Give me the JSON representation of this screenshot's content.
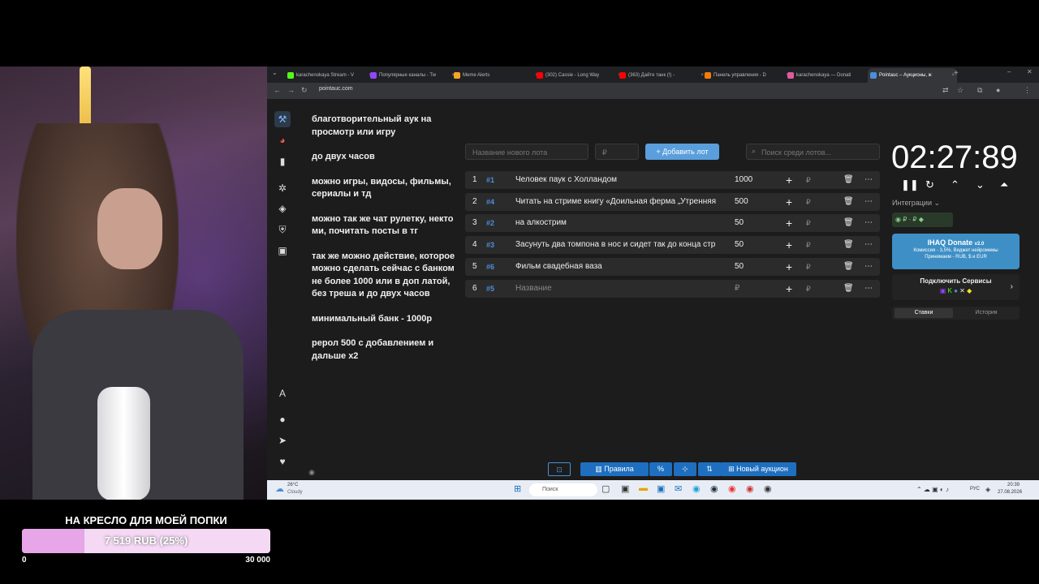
{
  "goal": {
    "title": "НА КРЕСЛО ДЛЯ МОЕЙ ПОПКИ",
    "progress_text": "7 519 RUB (25%)",
    "progress": 0.25,
    "min": "0",
    "max": "30 000",
    "fill_color": "#e6a6e8"
  },
  "browser": {
    "tabs": [
      {
        "label": "karachenokaya Stream - V",
        "icon_color": "#53fc18"
      },
      {
        "label": "Популярные каналы - Tw",
        "icon_color": "#9146ff"
      },
      {
        "label": "Meme Alerts",
        "icon_color": "#f5a623"
      },
      {
        "label": "(302) Cassie - Long Way",
        "icon_color": "#ff0000"
      },
      {
        "label": "(363) Дайте танк (!) -",
        "icon_color": "#ff0000"
      },
      {
        "label": "Панель управления - D",
        "icon_color": "#f57d07"
      },
      {
        "label": "karachenokaya — Donati",
        "icon_color": "#e05aa0"
      },
      {
        "label": "Pointauc – Аукционы, ж",
        "icon_color": "#4a8fd8"
      }
    ],
    "url": "pointauc.com"
  },
  "rules": [
    "благотворительный аук на просмотр или игру",
    "до  двух часов",
    "можно игры, видосы, фильмы, сериалы и тд",
    "можно так же чат рулетку, некто ми, почитать посты в тг",
    "так же можно действие, которое можно сделать сейчас с банком не более 1000 или в доп латой, без треша  и до двух часов",
    "минимальный банк - 1000р",
    "рерол 500 с добавлением и дальше х2"
  ],
  "inputs": {
    "lot_name_placeholder": "Название нового лота",
    "amount_placeholder": "₽",
    "add_button": "Добавить лот",
    "search_placeholder": "Поиск среди лотов..."
  },
  "lots": [
    {
      "num": "1",
      "id": "#1",
      "name": "Человек паук с Холландом",
      "amount": "1000"
    },
    {
      "num": "2",
      "id": "#4",
      "name": "Читать на стриме книгу «Доильная ферма „Утренняя",
      "amount": "500"
    },
    {
      "num": "3",
      "id": "#2",
      "name": "на алкострим",
      "amount": "50"
    },
    {
      "num": "4",
      "id": "#3",
      "name": "Засунуть два томпона в нос и сидет так до конца стр",
      "amount": "50"
    },
    {
      "num": "5",
      "id": "#6",
      "name": "Фильм свадебная ваза",
      "amount": "50"
    },
    {
      "num": "6",
      "id": "#5",
      "name": "Название",
      "amount": "₽"
    }
  ],
  "currency": "₽",
  "timer": "02:27:89",
  "integrations": {
    "label": "Интеграции",
    "ihaq_title": "IHAQ Donate",
    "ihaq_version": "v2.0",
    "ihaq_sub": "Комиссия - 3,5%, Виджет нейромемы",
    "ihaq_sub2": "Принимаем - RUB, $ и EUR",
    "services_title": "Подключить Сервисы",
    "tab_bets": "Ставки",
    "tab_history": "История"
  },
  "bottom": {
    "rules_button": "Правила",
    "percent_button": "%",
    "new_auction_button": "Новый аукцион"
  },
  "taskbar": {
    "weather_temp": "26°C",
    "weather_desc": "Cloudy",
    "search": "Поиск",
    "lang": "РУС",
    "time": "20:39",
    "date": "27.08.2026"
  }
}
